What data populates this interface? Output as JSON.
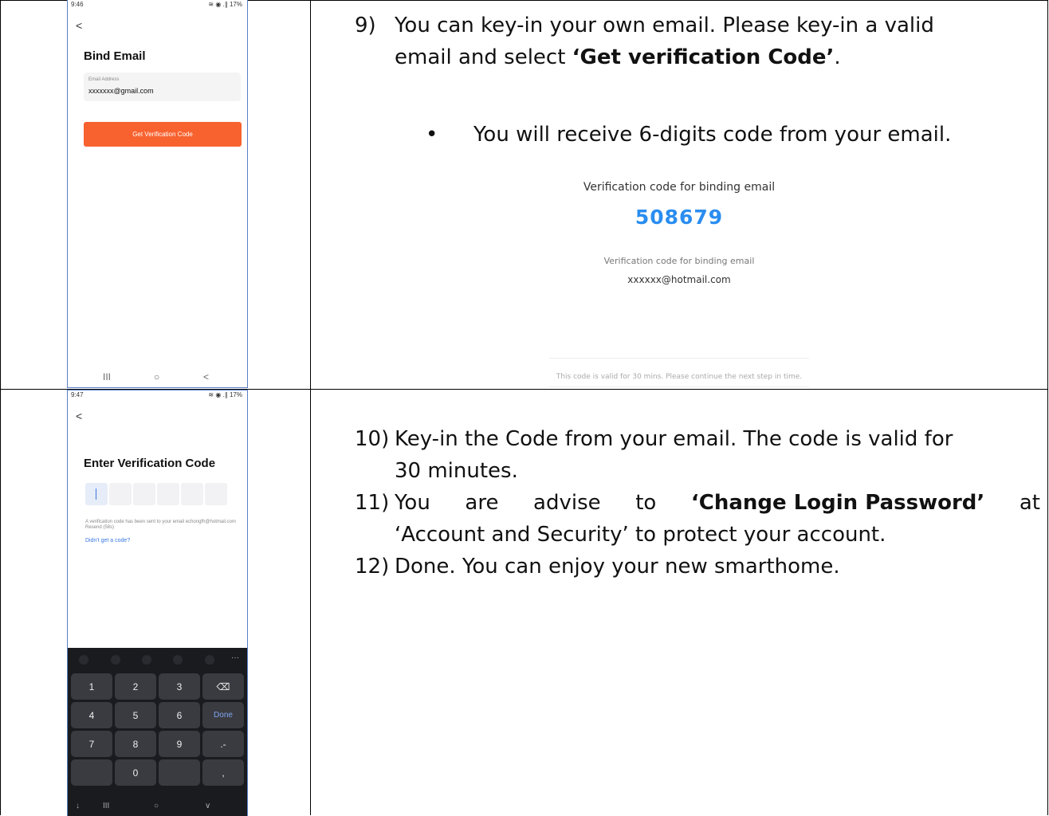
{
  "phone1": {
    "time": "9:46",
    "status_icons": "≋ ◉ .∥ 17%",
    "back": "<",
    "title": "Bind Email",
    "email_label": "Email Address",
    "email_value": "xxxxxxx@gmail.com",
    "button": "Get Verification Code",
    "nav": [
      "III",
      "○",
      "<"
    ]
  },
  "phone2": {
    "time": "9:47",
    "status_icons": "≋ ◉ .∥ 17%",
    "back": "<",
    "title": "Enter Verification Code",
    "sent_text": "A verification code has been sent to your email echongfh@hotmail.com Resend (58s)",
    "didnt_get": "Didn't get a code?",
    "keys": [
      "1",
      "2",
      "3",
      "⌫",
      "4",
      "5",
      "6",
      "Done",
      "7",
      "8",
      "9",
      ".-",
      "",
      "0",
      "",
      ","
    ],
    "toolbar_more": "···",
    "nav": [
      "↓",
      "III",
      "○",
      "∨"
    ]
  },
  "step9": {
    "num": "9)",
    "line1": "You can key-in your own email. Please key-in a valid",
    "line2_pre": "email and select ",
    "line2_bold": "‘Get verification Code’",
    "line2_post": ".",
    "bullet": "•",
    "bullet_text": "You will receive 6-digits code from your email."
  },
  "email_preview": {
    "title": "Verification code for binding email",
    "code": "508679",
    "subtitle": "Verification code for binding email",
    "address": "xxxxxx@hotmail.com",
    "footer": "This code is valid for 30 mins. Please continue the next step in time."
  },
  "step10": {
    "num": "10)",
    "line1": "Key-in the Code from your email. The code is valid for",
    "line2": "30 minutes."
  },
  "step11": {
    "num": "11)",
    "words": [
      "You",
      "are",
      "advise",
      "to",
      "‘Change Login Password’",
      "at"
    ],
    "line2": "‘Account and Security’ to protect your account."
  },
  "step12": {
    "num": "12)",
    "line1": "Done. You can enjoy your new smarthome."
  }
}
